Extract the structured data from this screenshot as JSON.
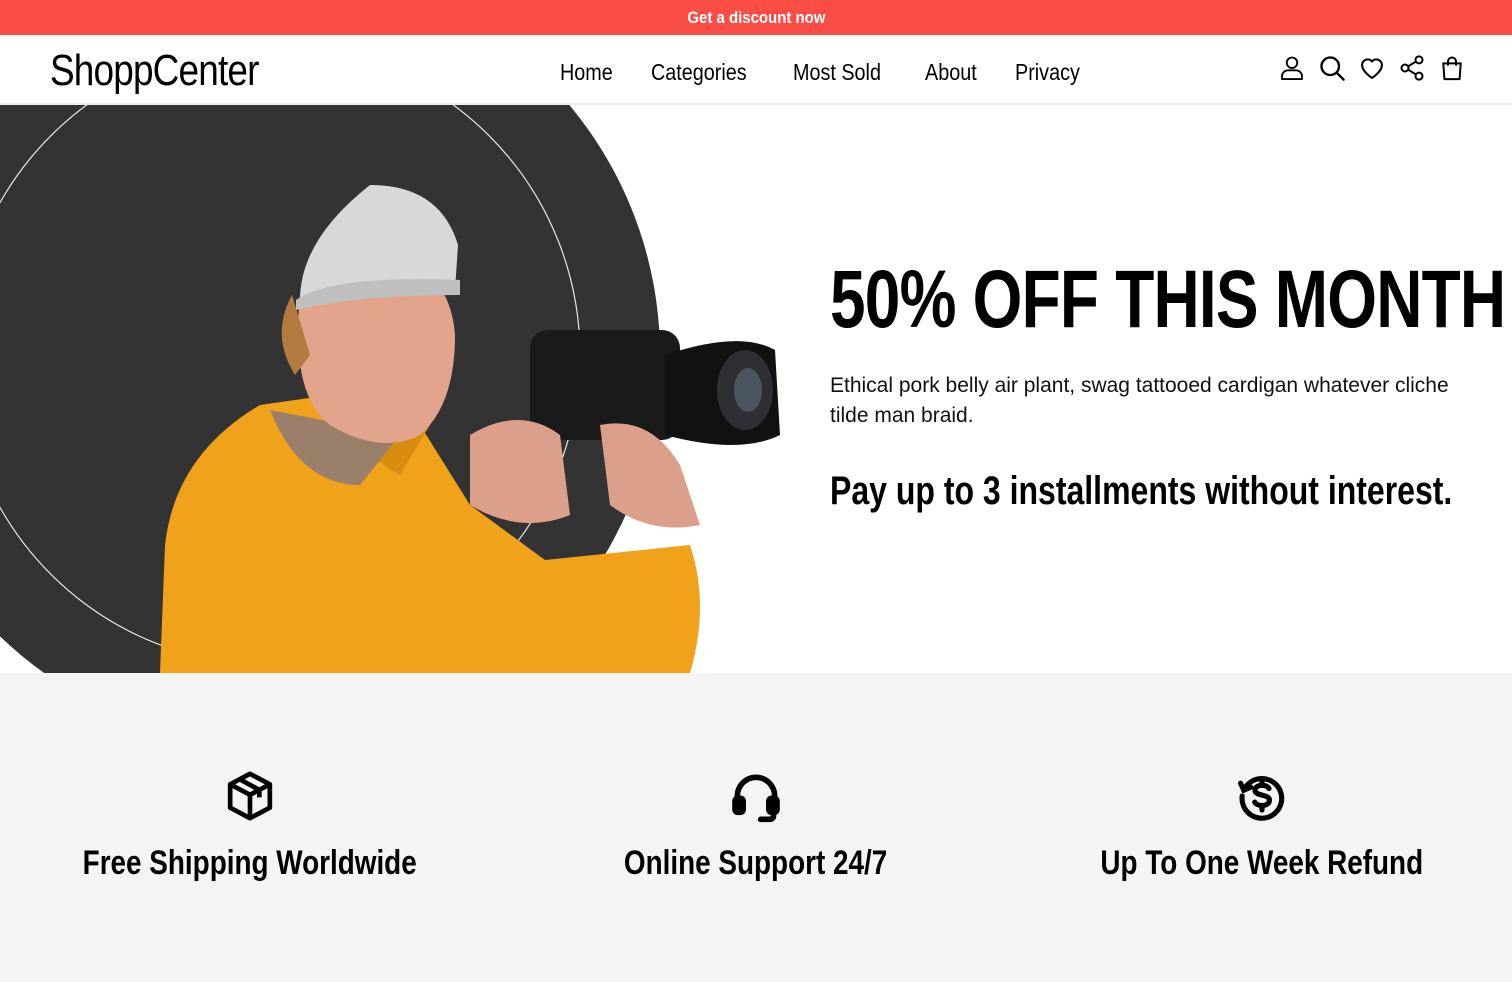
{
  "promo_bar": {
    "text": "Get a discount now",
    "color": "#f94d45"
  },
  "header": {
    "logo": "ShoppCenter",
    "nav": [
      {
        "label": "Home"
      },
      {
        "label": "Categories"
      },
      {
        "label": "Most Sold"
      },
      {
        "label": "About"
      },
      {
        "label": "Privacy"
      }
    ],
    "icons": [
      "user-icon",
      "search-icon",
      "heart-icon",
      "share-icon",
      "bag-icon"
    ]
  },
  "hero": {
    "title": "50% OFF THIS MONTH",
    "description": "Ethical pork belly air plant, swag tattooed cardigan whatever cliche tilde man braid.",
    "installments": "Pay up to 3 installments without interest.",
    "backdrop_color": "#333333"
  },
  "features": [
    {
      "icon": "box-icon",
      "label": "Free Shipping Worldwide"
    },
    {
      "icon": "headset-icon",
      "label": "Online Support 24/7"
    },
    {
      "icon": "refund-icon",
      "label": "Up To One Week Refund"
    }
  ]
}
